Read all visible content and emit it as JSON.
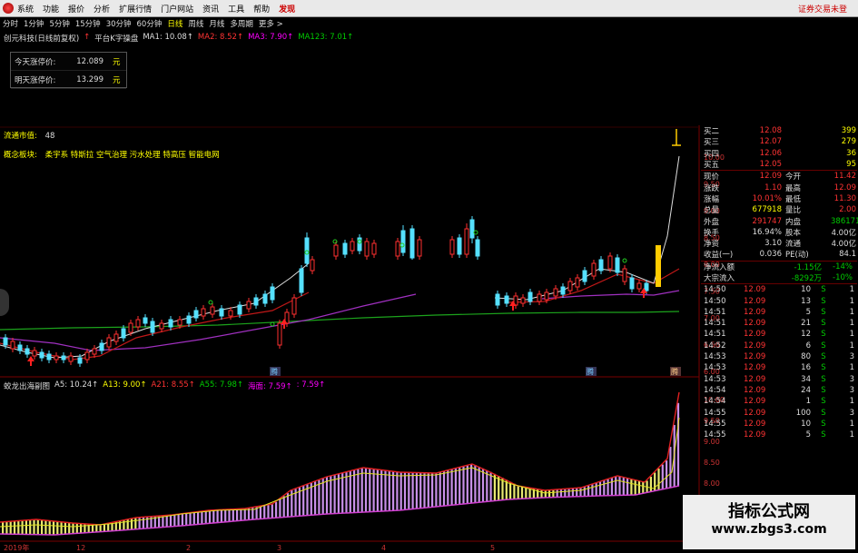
{
  "menu": {
    "items": [
      "系统",
      "功能",
      "报价",
      "分析",
      "扩展行情",
      "门户网站",
      "资讯",
      "工具",
      "帮助",
      "发现"
    ],
    "right": "证券交易未登"
  },
  "periods": [
    "分时",
    "1分钟",
    "5分钟",
    "15分钟",
    "30分钟",
    "60分钟",
    "日线",
    "周线",
    "月线",
    "多周期",
    "更多 >"
  ],
  "title": {
    "stock": "创元科技(日线前复权)",
    "indicator": "平台K字操盘",
    "ma1": "MA1: 10.08↑",
    "ma2": "MA2: 8.52↑",
    "ma3": "MA3: 7.90↑",
    "ma123": "MA123: 7.01↑"
  },
  "pricebox": {
    "today_label": "今天涨停价:",
    "today_value": "12.089",
    "today_unit": "元",
    "tomorrow_label": "明天涨停价:",
    "tomorrow_value": "13.299",
    "tomorrow_unit": "元"
  },
  "info": {
    "float_label": "流通市值:",
    "float_value": "48",
    "concept_label": "概念板块:",
    "concept_value": "柔宇系 特斯拉 空气治理 污水处理 特高压 智能电网"
  },
  "lower_title": {
    "name": "蛟龙出海副图",
    "a5": "A5: 10.24↑",
    "a13": "A13: 9.00↑",
    "a21": "A21: 8.55↑",
    "a55": "A55: 7.98↑",
    "hai": "海面: 7.59↑",
    "hai2": ": 7.59↑"
  },
  "price_axis": [
    "10.00",
    "9.50",
    "9.00",
    "8.50",
    "8.00",
    "7.50",
    "7.00",
    "6.50",
    "6.00"
  ],
  "lower_axis": [
    "10.00",
    "9.50",
    "9.00",
    "8.50",
    "8.00",
    "7.50"
  ],
  "date_axis": [
    "2019年",
    "12",
    "2",
    "3",
    "4",
    "5"
  ],
  "chart_markers": {
    "m1": "腾",
    "m2": "腾",
    "m3": "腾"
  },
  "quote": {
    "bids": [
      {
        "label": "买二",
        "price": "12.08",
        "vol": "399"
      },
      {
        "label": "买三",
        "price": "12.07",
        "vol": "279"
      },
      {
        "label": "买四",
        "price": "12.06",
        "vol": "36"
      },
      {
        "label": "买五",
        "price": "12.05",
        "vol": "95"
      }
    ],
    "stats": [
      {
        "l1": "现价",
        "v1": "12.09",
        "l2": "今开",
        "v2": "11.42"
      },
      {
        "l1": "涨跌",
        "v1": "1.10",
        "l2": "最高",
        "v2": "12.09"
      },
      {
        "l1": "涨幅",
        "v1": "10.01%",
        "l2": "最低",
        "v2": "11.30"
      },
      {
        "l1": "总量",
        "v1": "677918",
        "l2": "量比",
        "v2": "2.00"
      },
      {
        "l1": "外盘",
        "v1": "291747",
        "l2": "内盘",
        "v2": "386171"
      },
      {
        "l1": "换手",
        "v1": "16.94%",
        "l2": "股本",
        "v2": "4.00亿"
      },
      {
        "l1": "净资",
        "v1": "3.10",
        "l2": "流通",
        "v2": "4.00亿"
      },
      {
        "l1": "收益(一)",
        "v1": "0.036",
        "l2": "PE(动)",
        "v2": "84.1"
      }
    ],
    "flows": [
      {
        "label": "净流入额",
        "v1": "-1.15亿",
        "v2": "-14%"
      },
      {
        "label": "大宗流入",
        "v1": "-8292万",
        "v2": "-10%"
      }
    ],
    "ticks": [
      {
        "t": "14:50",
        "p": "12.09",
        "q": "10",
        "s": "S",
        "n": "1"
      },
      {
        "t": "14:50",
        "p": "12.09",
        "q": "13",
        "s": "S",
        "n": "1"
      },
      {
        "t": "14:51",
        "p": "12.09",
        "q": "5",
        "s": "S",
        "n": "1"
      },
      {
        "t": "14:51",
        "p": "12.09",
        "q": "21",
        "s": "S",
        "n": "1"
      },
      {
        "t": "14:51",
        "p": "12.09",
        "q": "12",
        "s": "S",
        "n": "1"
      },
      {
        "t": "14:52",
        "p": "12.09",
        "q": "6",
        "s": "S",
        "n": "1"
      },
      {
        "t": "14:53",
        "p": "12.09",
        "q": "80",
        "s": "S",
        "n": "3"
      },
      {
        "t": "14:53",
        "p": "12.09",
        "q": "16",
        "s": "S",
        "n": "1"
      },
      {
        "t": "14:53",
        "p": "12.09",
        "q": "34",
        "s": "S",
        "n": "3"
      },
      {
        "t": "14:54",
        "p": "12.09",
        "q": "24",
        "s": "S",
        "n": "3"
      },
      {
        "t": "14:54",
        "p": "12.09",
        "q": "1",
        "s": "S",
        "n": "1"
      },
      {
        "t": "14:55",
        "p": "12.09",
        "q": "100",
        "s": "S",
        "n": "3"
      },
      {
        "t": "14:55",
        "p": "12.09",
        "q": "10",
        "s": "S",
        "n": "1"
      },
      {
        "t": "14:55",
        "p": "12.09",
        "q": "5",
        "s": "S",
        "n": "1"
      }
    ]
  },
  "watermark": {
    "line1": "指标公式网",
    "line2": "www.zbgs3.com"
  }
}
